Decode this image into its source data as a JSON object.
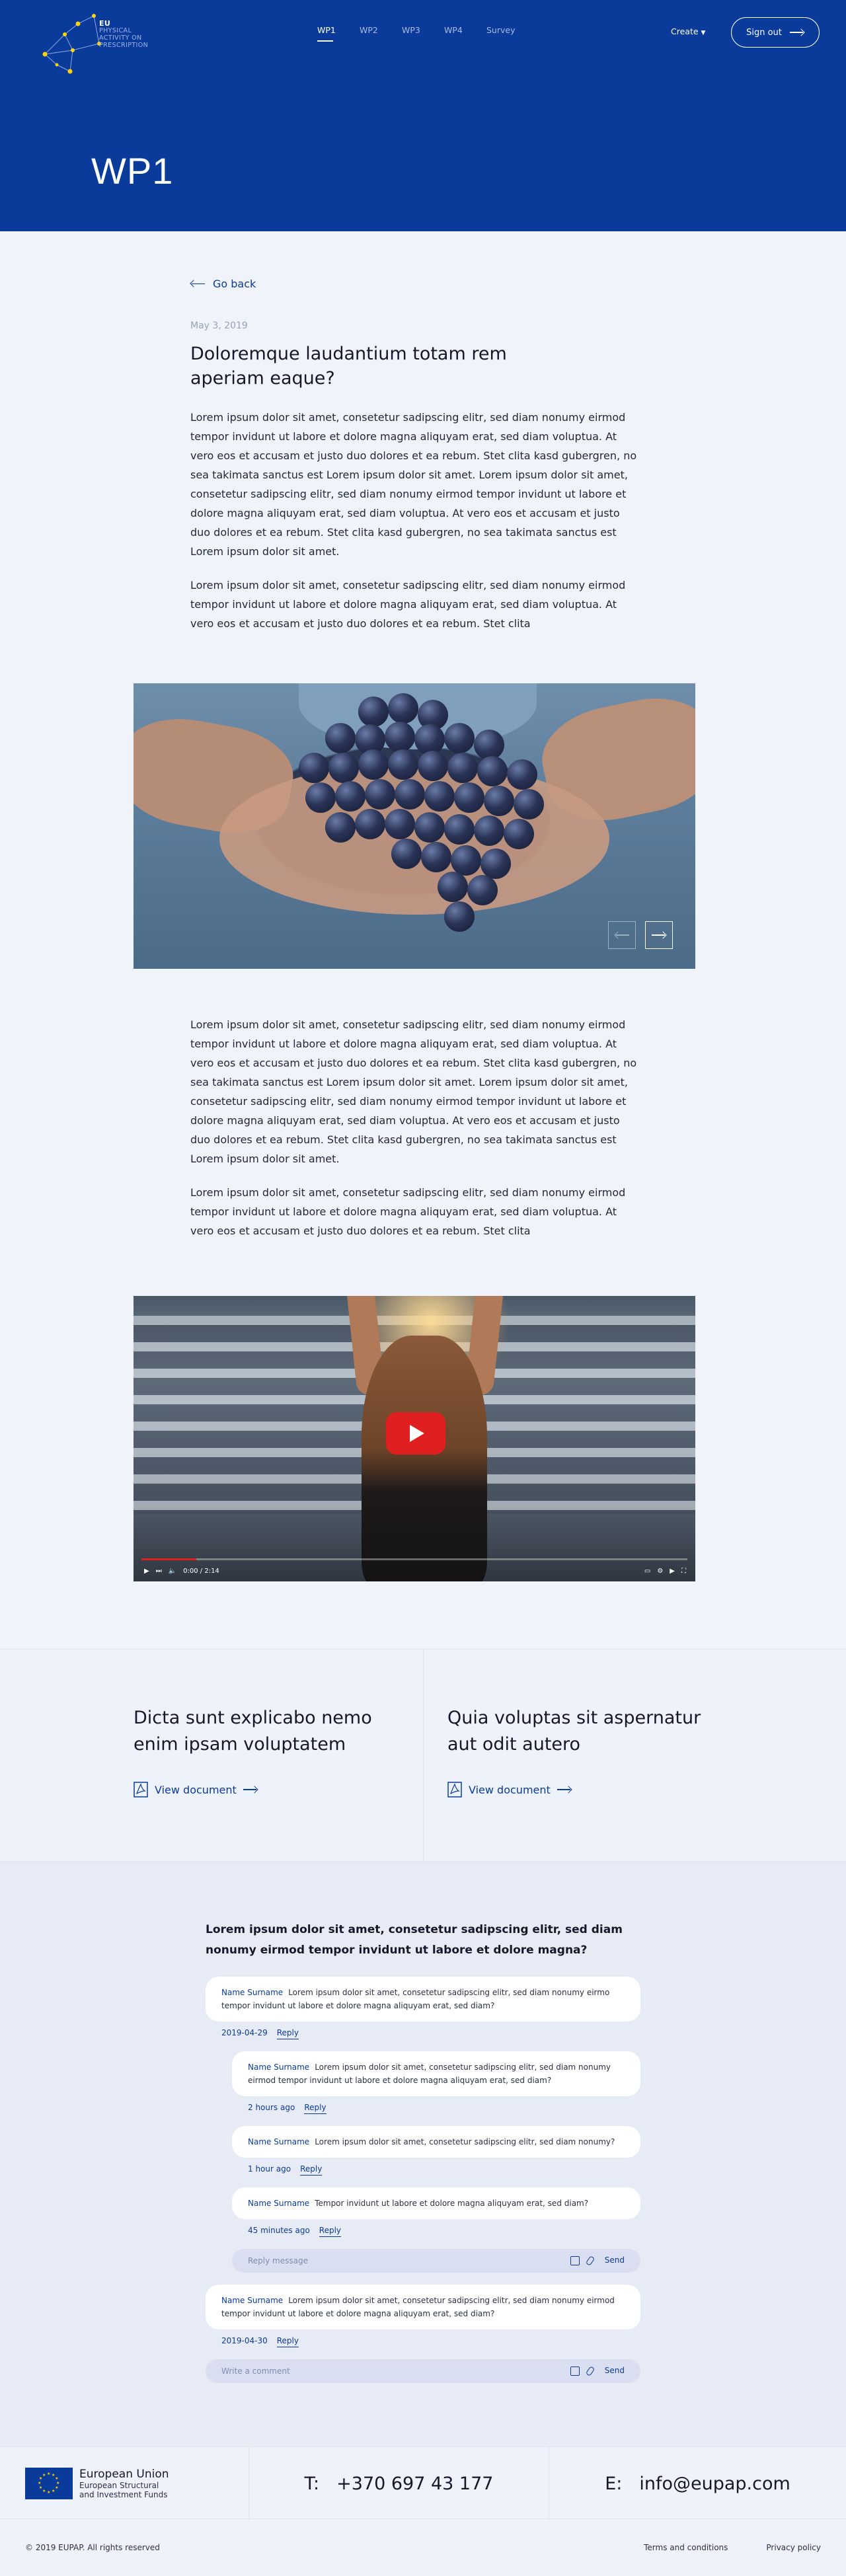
{
  "brand": {
    "logo_line1": "EU",
    "logo_line2": "PHYSICAL",
    "logo_line3": "ACTIVITY ON",
    "logo_line4": "PRESCRIPTION"
  },
  "nav": {
    "items": [
      {
        "label": "WP1"
      },
      {
        "label": "WP2"
      },
      {
        "label": "WP3"
      },
      {
        "label": "WP4"
      },
      {
        "label": "Survey"
      }
    ],
    "create_label": "Create",
    "signout_label": "Sign out"
  },
  "hero": {
    "title": "WP1"
  },
  "article": {
    "go_back": "Go back",
    "date": "May 3, 2019",
    "headline": "Doloremque laudantium totam rem aperiam eaque?",
    "para1": "Lorem ipsum dolor sit amet, consetetur sadipscing elitr, sed diam nonumy eirmod tempor invidunt ut labore et dolore magna aliquyam erat, sed diam voluptua. At vero eos et accusam et justo duo dolores et ea rebum. Stet clita kasd gubergren, no sea takimata sanctus est Lorem ipsum dolor sit amet. Lorem ipsum dolor sit amet, consetetur sadipscing elitr, sed diam nonumy eirmod tempor invidunt ut labore et dolore magna aliquyam erat, sed diam voluptua. At vero eos et accusam et justo duo dolores et ea rebum. Stet clita kasd gubergren, no sea takimata sanctus est Lorem ipsum dolor sit amet.",
    "para2": "Lorem ipsum dolor sit amet, consetetur sadipscing elitr, sed diam nonumy eirmod tempor invidunt ut labore et dolore magna aliquyam erat, sed diam voluptua. At vero eos et accusam et justo duo dolores et ea rebum. Stet clita",
    "para3": "Lorem ipsum dolor sit amet, consetetur sadipscing elitr, sed diam nonumy eirmod tempor invidunt ut labore et dolore magna aliquyam erat, sed diam voluptua. At vero eos et accusam et justo duo dolores et ea rebum. Stet clita kasd gubergren, no sea takimata sanctus est Lorem ipsum dolor sit amet. Lorem ipsum dolor sit amet, consetetur sadipscing elitr, sed diam nonumy eirmod tempor invidunt ut labore et dolore magna aliquyam erat, sed diam voluptua. At vero eos et accusam et justo duo dolores et ea rebum. Stet clita kasd gubergren, no sea takimata sanctus est Lorem ipsum dolor sit amet.",
    "para4": "Lorem ipsum dolor sit amet, consetetur sadipscing elitr, sed diam nonumy eirmod tempor invidunt ut labore et dolore magna aliquyam erat, sed diam voluptua. At vero eos et accusam et justo duo dolores et ea rebum. Stet clita"
  },
  "gallery": {
    "prev_icon": "arrow-left-icon",
    "next_icon": "arrow-right-icon"
  },
  "video": {
    "time": "0:00 / 2:14",
    "progress": 0.1
  },
  "documents": [
    {
      "title": "Dicta sunt explicabo nemo enim ipsam voluptatem",
      "link": "View document"
    },
    {
      "title": "Quia voluptas sit aspernatur aut odit autero",
      "link": "View document"
    }
  ],
  "comments": {
    "question": "Lorem ipsum dolor sit amet, consetetur sadipscing elitr, sed diam nonumy eirmod tempor invidunt ut labore et dolore magna?",
    "reply_label": "Reply",
    "send_label": "Send",
    "reply_placeholder": "Reply message",
    "comment_placeholder": "Write a comment",
    "thread": [
      {
        "author": "Name Surname",
        "text": "Lorem ipsum dolor sit amet, consetetur sadipscing elitr, sed diam nonumy eirmo tempor invidunt ut labore et dolore magna aliquyam erat, sed diam?",
        "time": "2019-04-29",
        "replies": [
          {
            "author": "Name Surname",
            "text": "Lorem ipsum dolor sit amet, consetetur sadipscing elitr, sed diam nonumy eirmod tempor invidunt ut labore et dolore magna aliquyam erat, sed diam?",
            "time": "2 hours ago"
          },
          {
            "author": "Name Surname",
            "text": "Lorem ipsum dolor sit amet, consetetur sadipscing elitr, sed diam nonumy?",
            "time": "1 hour ago"
          },
          {
            "author": "Name Surname",
            "text": "Tempor invidunt ut labore et dolore magna aliquyam erat, sed diam?",
            "time": "45 minutes ago"
          }
        ]
      },
      {
        "author": "Name Surname",
        "text": "Lorem ipsum dolor sit amet, consetetur sadipscing elitr, sed diam nonumy eirmod tempor invidunt ut labore et dolore magna aliquyam erat, sed diam?",
        "time": "2019-04-30"
      }
    ]
  },
  "footer": {
    "eu_name": "European Union",
    "eu_sub1": "European Structural",
    "eu_sub2": "and Investment Funds",
    "phone_label": "T:",
    "phone": "+370 697 43 177",
    "email_label": "E:",
    "email": "info@eupap.com",
    "copyright": "© 2019 EUPAP. All rights reserved",
    "terms": "Terms and conditions",
    "privacy": "Privacy policy"
  }
}
